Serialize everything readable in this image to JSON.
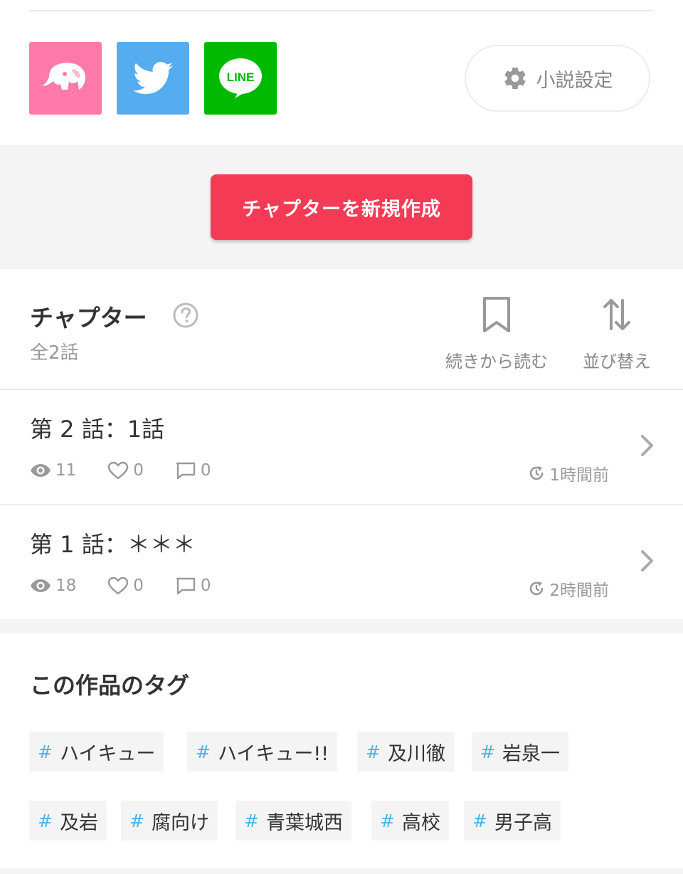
{
  "share": {
    "buttons": [
      {
        "name": "estar",
        "icon": "elephant-icon",
        "color": "#ff7aa8"
      },
      {
        "name": "twitter",
        "icon": "twitter-bird-icon",
        "color": "#55acee"
      },
      {
        "name": "line",
        "icon": "line-icon",
        "label": "LINE",
        "color": "#00b900"
      }
    ]
  },
  "settings": {
    "label": "小説設定",
    "icon": "gear-icon"
  },
  "create": {
    "label": "チャプターを新規作成",
    "color": "#f43a55"
  },
  "chapters": {
    "title": "チャプター",
    "count": "全2話",
    "continue_label": "続きから読む",
    "sort_label": "並び替え",
    "items": [
      {
        "title": "第 2 話：1話",
        "views": "11",
        "likes": "0",
        "comments": "0",
        "time": "1時間前"
      },
      {
        "title": "第 1 話：＊＊＊",
        "views": "18",
        "likes": "0",
        "comments": "0",
        "time": "2時間前"
      }
    ]
  },
  "tags": {
    "heading": "この作品のタグ",
    "hash": "#",
    "items": [
      "ハイキュー",
      "ハイキュー!!",
      "及川徹",
      "岩泉一",
      "及岩",
      "腐向け",
      "青葉城西",
      "高校",
      "男子高"
    ]
  }
}
